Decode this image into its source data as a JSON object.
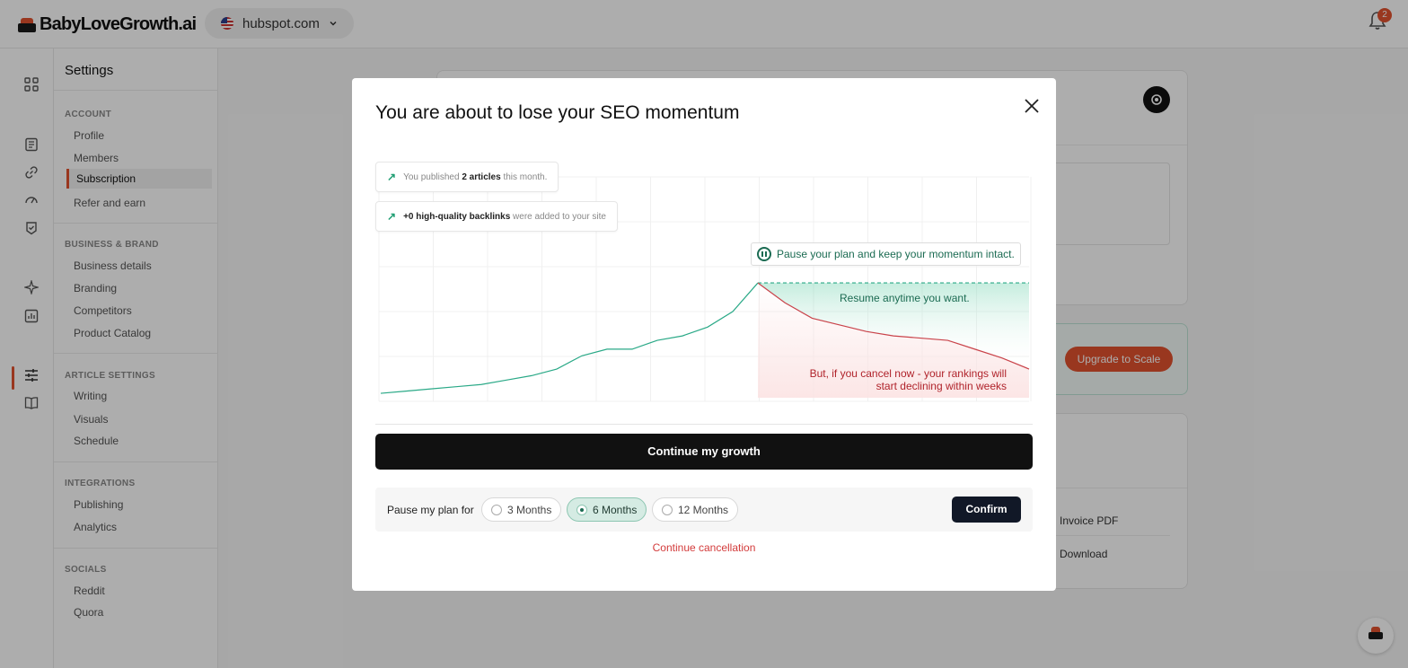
{
  "app": {
    "logo_text": "BabyLoveGrowth.ai",
    "domain": "hubspot.com",
    "notifications": "2"
  },
  "rail": {
    "icons": [
      "grid-icon",
      "document-icon",
      "link-icon",
      "gauge-icon",
      "check-badge-icon",
      "sparkle-icon",
      "chart-icon",
      "sliders-icon",
      "book-icon"
    ]
  },
  "settings": {
    "title": "Settings",
    "sections": [
      {
        "header": "ACCOUNT",
        "items": [
          "Profile",
          "Members",
          "Subscription",
          "Refer and earn"
        ]
      },
      {
        "header": "BUSINESS & BRAND",
        "items": [
          "Business details",
          "Branding",
          "Competitors",
          "Product Catalog"
        ]
      },
      {
        "header": "ARTICLE SETTINGS",
        "items": [
          "Writing",
          "Visuals",
          "Schedule"
        ]
      },
      {
        "header": "INTEGRATIONS",
        "items": [
          "Publishing",
          "Analytics"
        ]
      },
      {
        "header": "SOCIALS",
        "items": [
          "Reddit",
          "Quora"
        ]
      }
    ],
    "active_item": "Subscription"
  },
  "background": {
    "upgrade_label": "Upgrade to Scale",
    "invoice_label": "Invoice PDF",
    "download_label": "Download"
  },
  "modal": {
    "title": "You are about to lose your SEO momentum",
    "stat1": {
      "prefix": "You published",
      "bold": "2 articles",
      "suffix": "this month."
    },
    "stat2": {
      "bold": "+0 high-quality backlinks",
      "suffix": "were added to your site"
    },
    "pause_label": "Pause your plan and keep your momentum intact.",
    "resume_label": "Resume anytime you want.",
    "cancel_warning": "But, if you cancel now - your rankings will start declining within weeks",
    "continue_button": "Continue my growth",
    "pause_for_label": "Pause my plan for",
    "options": [
      "3 Months",
      "6 Months",
      "12 Months"
    ],
    "selected_option": "6 Months",
    "confirm_button": "Confirm",
    "cancel_link": "Continue cancellation"
  },
  "chart_data": {
    "type": "line",
    "title": "",
    "xlabel": "",
    "ylabel": "",
    "grid": true,
    "ylim": [
      0,
      100
    ],
    "series": [
      {
        "values": [
          2,
          3,
          4,
          5,
          6,
          8,
          10,
          13,
          19,
          22,
          22,
          26,
          28,
          32,
          39,
          52
        ],
        "color": "#2aa987"
      },
      {
        "values": [
          52,
          52,
          52,
          52,
          52,
          52,
          52,
          52,
          52,
          52,
          52
        ],
        "color": "#2aa987",
        "style": "dashed"
      },
      {
        "values": [
          52,
          43,
          36,
          33,
          30,
          28,
          27,
          26,
          22,
          18,
          13
        ],
        "color": "#c9434a"
      }
    ]
  }
}
